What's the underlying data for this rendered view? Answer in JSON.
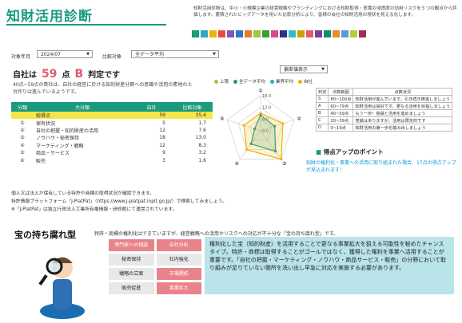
{
  "header": {
    "title": "知財活用診断",
    "description": "知財活用診断は、中小・小規模企業の経営戦略やブランディングにおける知財取得・意識の浸透度の効用リスクを５つの観点から評価します。蓄積されたビッグデータを用いた比較分析により、皆様の会社の知財活用の現状を見える化します。"
  },
  "swatch_colors": [
    "#1a9a7e",
    "#2aa8c4",
    "#f0b400",
    "#e44b4b",
    "#7c59b4",
    "#2b79c2",
    "#e37b2a",
    "#9acb3f",
    "#3b9d3a",
    "#d94c8c",
    "#2e2e8f",
    "#3cb9c7",
    "#c9a300",
    "#e55e5e",
    "#7a3e96",
    "#148c6a",
    "#e88c2c",
    "#5a9bd5",
    "#b0d236",
    "#a12b5a"
  ],
  "filters": {
    "period_label": "対象年月",
    "period_value": "2024/07",
    "compare_label": "比較対象",
    "compare_value": "全データ平均",
    "display_value": "偏差値表示"
  },
  "score": {
    "prefix": "自社は",
    "value": "59",
    "unit": "点",
    "grade": "B",
    "suffix": "判定です",
    "note": "40点~59点の貴社は、自社の経営に於ける知的財産分野への意識や活用の素地の土台作りは進んでいるようです。"
  },
  "category_table": {
    "headers": [
      "分類",
      "大分類",
      "自社",
      "比較対象"
    ],
    "rows": [
      {
        "no": "",
        "name": "総得点",
        "own": "59",
        "cmp": "35.4"
      },
      {
        "no": "①",
        "name": "保有状況",
        "own": "5",
        "cmp": "1.7"
      },
      {
        "no": "②",
        "name": "自社の把握・知的財産の活用",
        "own": "12",
        "cmp": "7.6"
      },
      {
        "no": "③",
        "name": "ノウハウ・秘密保持",
        "own": "18",
        "cmp": "13.0"
      },
      {
        "no": "④",
        "name": "マーケティング・戦略",
        "own": "12",
        "cmp": "8.3"
      },
      {
        "no": "⑤",
        "name": "商品・サービス",
        "own": "9",
        "cmp": "3.2"
      },
      {
        "no": "⑥",
        "name": "販売",
        "own": "3",
        "cmp": "1.6"
      }
    ]
  },
  "legend": [
    {
      "label": "上限",
      "color": "#9acb3f"
    },
    {
      "label": "全データ平均",
      "color": "#1a9a7e"
    },
    {
      "label": "業界平均",
      "color": "#2aa8c4"
    },
    {
      "label": "自社",
      "color": "#f0b400"
    }
  ],
  "chart_data": {
    "type": "radar",
    "axes": [
      "①",
      "②",
      "③",
      "④",
      "⑤"
    ],
    "tick_labels": [
      "0.0",
      "6.0",
      "12.0",
      "18.0"
    ],
    "range": [
      0,
      18
    ],
    "series": [
      {
        "name": "全データ平均",
        "values": [
          8,
          7.6,
          13,
          8.3,
          3.2
        ],
        "color": "#1a9a7e"
      },
      {
        "name": "自社",
        "values": [
          9,
          12,
          18,
          12,
          9
        ],
        "color": "#f0b400"
      }
    ]
  },
  "grade_table": {
    "headers": [
      "判定",
      "点数範囲",
      "点数状況"
    ],
    "rows": [
      {
        "grade": "S",
        "range": "80~100点",
        "status": "知財活用が進んでいます。引き続き推進しましょう"
      },
      {
        "grade": "A",
        "range": "60~79点",
        "status": "知財活用は良好です。更なる活用を目指しましょう"
      },
      {
        "grade": "B",
        "range": "40~59点",
        "status": "もう一歩！意識と活用を進めましょう"
      },
      {
        "grade": "C",
        "range": "20~39点",
        "status": "意識はありますが、活用は限定的です"
      },
      {
        "grade": "D",
        "range": "0~19点",
        "status": "知財活用の第一歩を踏み出しましょう"
      }
    ]
  },
  "tips": {
    "heading": "得点アップのポイント",
    "text": "知財の権利化・事業への活用に取り組まれた場合、17点の得点アップが見込まれます！"
  },
  "source": {
    "line1": "個人又は法人が保有している特許や商標の取得状況が確認できます。",
    "line2": "特許情報プラットフォーム「J-PlatPat」（https://www.j-platpat.inpit.go.jp/）で検索してみましょう。",
    "line3": "※「J-PlatPat」は独立行政法人工業所有権情報・研修館にて運営されています。"
  },
  "treasure": {
    "title": "宝の持ち腐れ型",
    "note": "特許・商標の権利化はできていますが、経営戦略への活用やリスクへの対応が不十分な「宝の持ち腐れ型」です。",
    "keywords": [
      {
        "label": "専門家への相談",
        "type": "p"
      },
      {
        "label": "自社分析",
        "type": "p"
      },
      {
        "label": "秘密保持",
        "type": "g"
      },
      {
        "label": "社内強化",
        "type": "g"
      },
      {
        "label": "戦略の立案",
        "type": "g"
      },
      {
        "label": "市場開拓",
        "type": "p"
      },
      {
        "label": "販売促進",
        "type": "g"
      },
      {
        "label": "事業拡大",
        "type": "p"
      }
    ],
    "detail": "権利化した宝（知的財産）を活用することで更なる事業拡大を狙える可能性を秘めたチャンスタイプ。特許・商標は取得することがゴールではなく、獲得した権利を事業へ活用することが重要です。「自社の把握・マーケティング・ノウハウ・商品サービス・販売」の分野において取り組みが足りていない箇所を洗い出し早急に対応を実施する必要があります。"
  }
}
